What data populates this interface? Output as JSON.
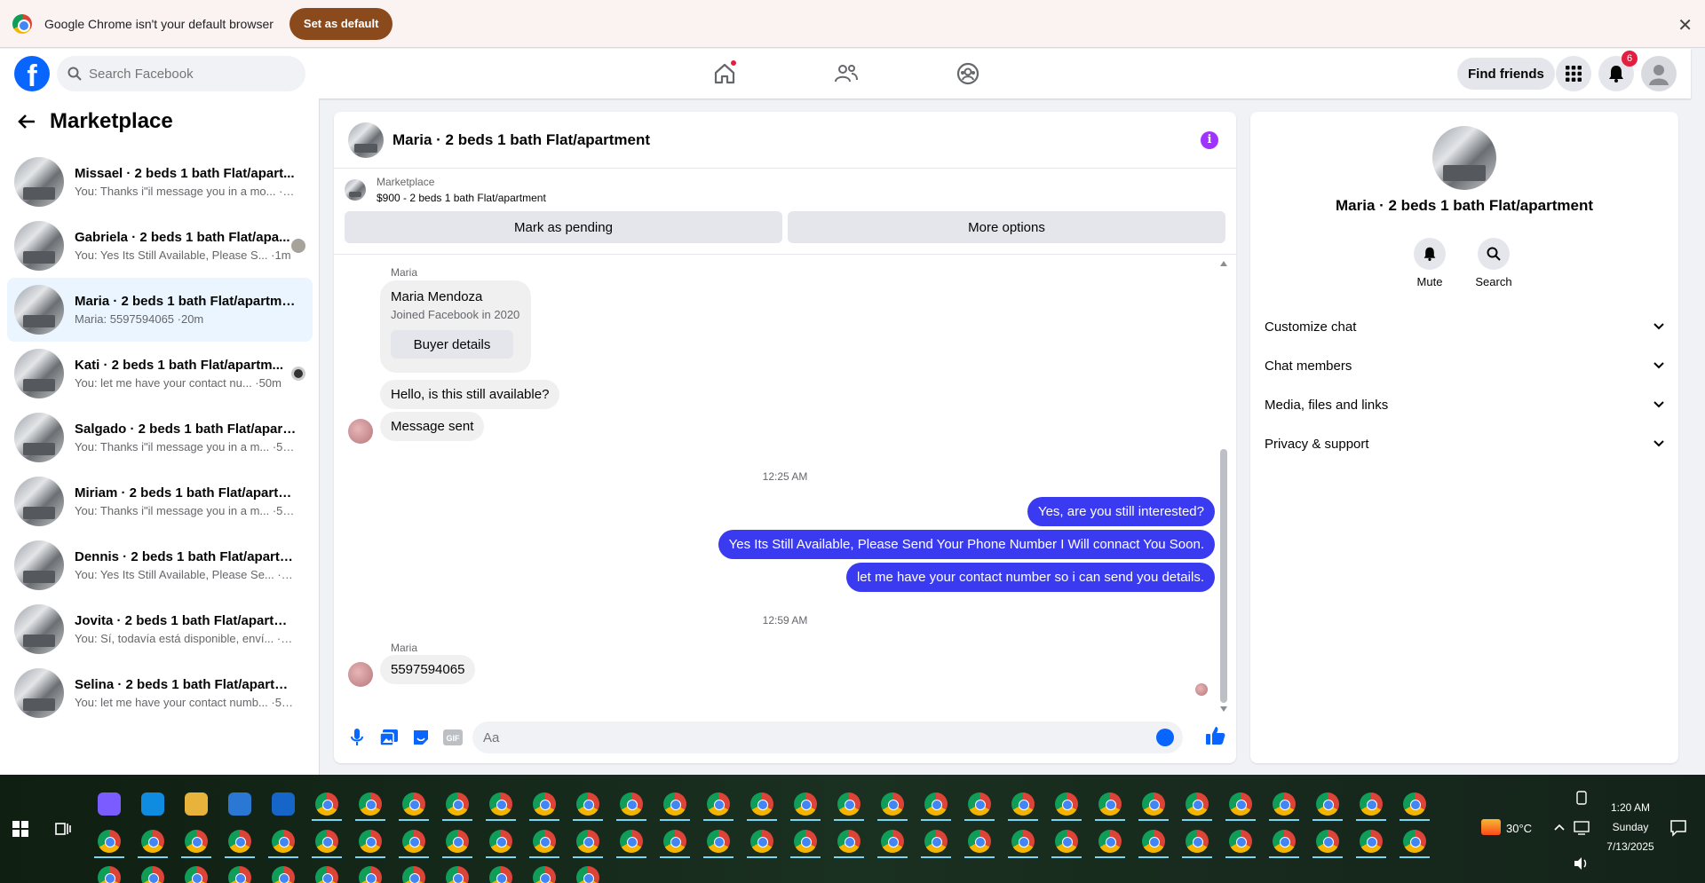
{
  "browser_bar": {
    "message": "Google Chrome isn't your default browser",
    "set_default_label": "Set as default"
  },
  "header": {
    "search_placeholder": "Search Facebook",
    "find_friends_label": "Find friends",
    "notification_count": "6"
  },
  "sidebar": {
    "title": "Marketplace",
    "conversations": [
      {
        "name": "Missael · 2 beds 1 bath Flat/apart...",
        "preview": "You: Thanks i\"il message you in a mo... ·1m"
      },
      {
        "name": "Gabriela · 2 beds 1 bath Flat/apa...",
        "preview": "You: Yes Its Still Available, Please S... ·1m"
      },
      {
        "name": "Maria · 2 beds 1 bath Flat/apartment",
        "preview": "Maria: 5597594065 ·20m"
      },
      {
        "name": "Kati · 2 beds 1 bath Flat/apartm...",
        "preview": "You: let me have your contact nu... ·50m"
      },
      {
        "name": "Salgado · 2 beds 1 bath Flat/apart...",
        "preview": "You: Thanks i\"il message you in a m... ·52m"
      },
      {
        "name": "Miriam · 2 beds 1 bath Flat/apartm...",
        "preview": "You: Thanks i\"il message you in a m... ·53m"
      },
      {
        "name": "Dennis · 2 beds 1 bath Flat/apartm...",
        "preview": "You: Yes Its Still Available, Please Se... ·54m"
      },
      {
        "name": "Jovita · 2 beds 1 bath Flat/apartme...",
        "preview": "You: Sí, todavía está disponible, enví... ·54m"
      },
      {
        "name": "Selina · 2 beds 1 bath Flat/apartme...",
        "preview": "You: let me have your contact numb... ·55m"
      }
    ]
  },
  "chat": {
    "title": "Maria · 2 beds 1 bath Flat/apartment",
    "listing_category": "Marketplace",
    "listing_title": "$900 - 2 beds 1 bath Flat/apartment",
    "mark_pending_label": "Mark as pending",
    "more_options_label": "More options",
    "sender_name": "Maria",
    "buyer_name": "Maria Mendoza",
    "buyer_joined": "Joined Facebook in 2020",
    "buyer_details_label": "Buyer details",
    "msg_in_1": "Hello, is this still available?",
    "msg_in_2": "Message sent",
    "time_1": "12:25 AM",
    "msg_out_1": "Yes, are you still interested?",
    "msg_out_2": "Yes Its Still Available, Please Send Your Phone Number I Will connact You Soon.",
    "msg_out_3": "let me have your contact number so i can send you details.",
    "time_2": "12:59 AM",
    "msg_in_3": "5597594065",
    "composer_placeholder": "Aa"
  },
  "details": {
    "name": "Maria · 2 beds 1 bath Flat/apartment",
    "mute_label": "Mute",
    "search_label": "Search",
    "sections": [
      "Customize chat",
      "Chat members",
      "Media, files and links",
      "Privacy & support"
    ]
  },
  "taskbar": {
    "weather": "30°C",
    "time": "1:20 AM",
    "day": "Sunday",
    "date": "7/13/2025"
  }
}
